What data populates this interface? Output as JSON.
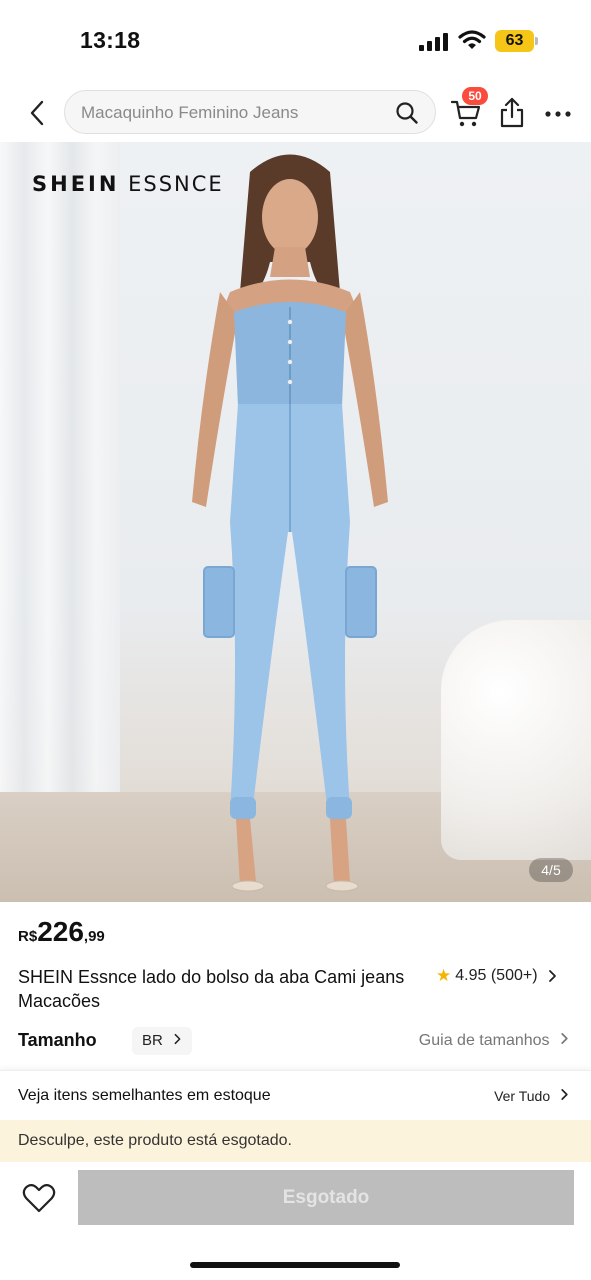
{
  "status_bar": {
    "time": "13:18",
    "battery_level": "63",
    "icons": [
      "signal-icon",
      "wifi-icon",
      "battery-icon"
    ]
  },
  "nav": {
    "search_placeholder": "Macaquinho Feminino Jeans",
    "cart_badge": "50",
    "icons": [
      "back-arrow-icon",
      "search-icon",
      "cart-icon",
      "share-icon",
      "more-icon"
    ]
  },
  "gallery": {
    "brand_part1": "SHEIN",
    "brand_part2": "ESSNCE",
    "page_indicator": "4/5"
  },
  "product": {
    "price_currency": "R$",
    "price_integer": "226",
    "price_decimal": ",99",
    "title": "SHEIN Essnce lado do bolso da aba Cami jeans Macacões",
    "rating_value": "4.95",
    "rating_count": "(500+)"
  },
  "size": {
    "label": "Tamanho",
    "region": "BR",
    "guide_label": "Guia de tamanhos"
  },
  "similar": {
    "text": "Veja itens semelhantes em estoque",
    "link": "Ver Tudo"
  },
  "notice": {
    "text": "Desculpe, este produto está esgotado."
  },
  "actions": {
    "soldout_label": "Esgotado"
  },
  "colors": {
    "accent_red": "#fa4b3c",
    "battery_yellow": "#f5c518",
    "star_yellow": "#f5b400",
    "notice_bg": "#fcf3dc",
    "disabled_button": "#bdbdbd"
  }
}
